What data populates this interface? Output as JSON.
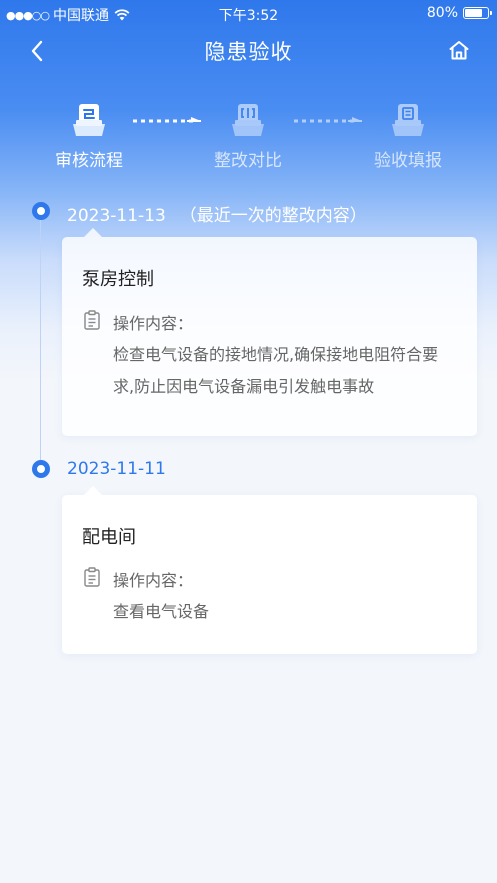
{
  "status_bar": {
    "carrier": "中国联通",
    "time": "下午3:52",
    "battery": "80%",
    "battery_level": 0.8
  },
  "nav": {
    "title": "隐患验收",
    "back_icon": "chevron-left-icon",
    "home_icon": "home-icon"
  },
  "steps": [
    {
      "label": "审核流程",
      "state": "active",
      "icon": "review-flow-icon"
    },
    {
      "label": "整改对比",
      "state": "inactive",
      "icon": "compare-icon"
    },
    {
      "label": "验收填报",
      "state": "inactive",
      "icon": "form-fill-icon"
    }
  ],
  "timeline": [
    {
      "date": "2023-11-13",
      "note": "（最近一次的整改内容）",
      "title": "泵房控制",
      "op_label": "操作内容：",
      "op_content": "检查电气设备的接地情况,确保接地电阻符合要求,防止因电气设备漏电引发触电事故"
    },
    {
      "date": "2023-11-11",
      "note": "",
      "title": "配电间",
      "op_label": "操作内容：",
      "op_content": "查看电气设备"
    }
  ],
  "colors": {
    "primary": "#2f78ec",
    "background": "#f3f6fb",
    "card": "#ffffff",
    "text_secondary": "#666666"
  }
}
